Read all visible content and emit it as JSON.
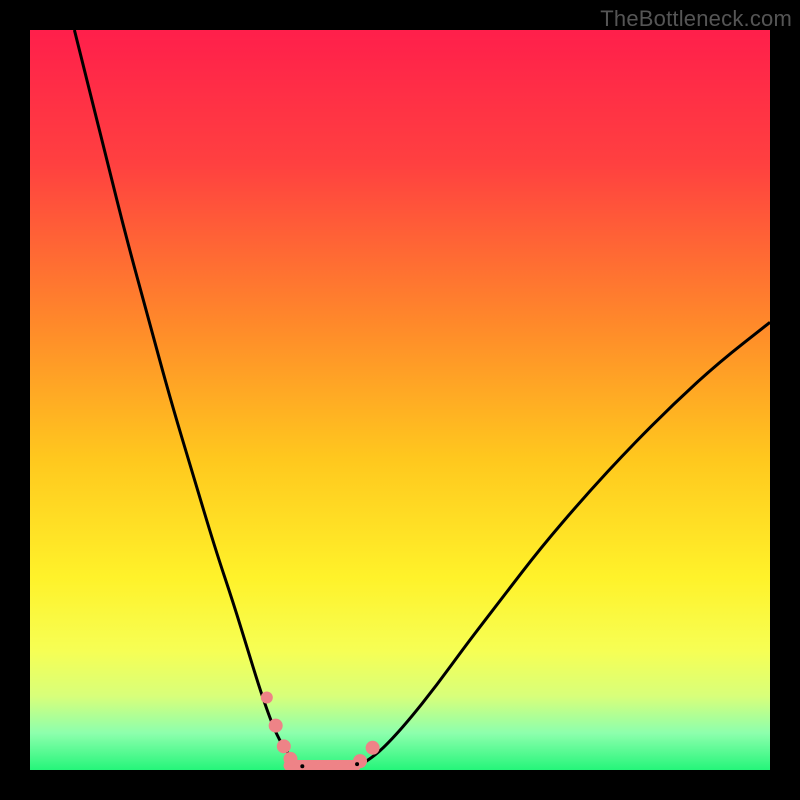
{
  "watermark": "TheBottleneck.com",
  "chart_data": {
    "type": "line",
    "title": "",
    "xlabel": "",
    "ylabel": "",
    "xlim": [
      0,
      100
    ],
    "ylim": [
      0,
      100
    ],
    "grid": false,
    "legend": false,
    "background_gradient_stops": [
      {
        "offset": 0.0,
        "color": "#ff1f4b"
      },
      {
        "offset": 0.18,
        "color": "#ff4040"
      },
      {
        "offset": 0.4,
        "color": "#ff8a2a"
      },
      {
        "offset": 0.58,
        "color": "#ffc81e"
      },
      {
        "offset": 0.74,
        "color": "#fff22a"
      },
      {
        "offset": 0.84,
        "color": "#f6ff55"
      },
      {
        "offset": 0.9,
        "color": "#d8ff7a"
      },
      {
        "offset": 0.95,
        "color": "#8dffad"
      },
      {
        "offset": 1.0,
        "color": "#25f57a"
      }
    ],
    "series": [
      {
        "name": "left-curve",
        "color": "#000000",
        "stroke_width": 3,
        "points": [
          {
            "x": 6.0,
            "y": 100.0
          },
          {
            "x": 8.0,
            "y": 92.0
          },
          {
            "x": 10.5,
            "y": 82.0
          },
          {
            "x": 13.0,
            "y": 72.0
          },
          {
            "x": 16.0,
            "y": 61.0
          },
          {
            "x": 19.0,
            "y": 50.0
          },
          {
            "x": 22.0,
            "y": 40.0
          },
          {
            "x": 25.0,
            "y": 30.0
          },
          {
            "x": 27.5,
            "y": 22.5
          },
          {
            "x": 29.5,
            "y": 16.0
          },
          {
            "x": 31.2,
            "y": 10.5
          },
          {
            "x": 32.8,
            "y": 6.0
          },
          {
            "x": 34.0,
            "y": 3.5
          },
          {
            "x": 35.2,
            "y": 1.8
          },
          {
            "x": 36.5,
            "y": 0.8
          },
          {
            "x": 37.5,
            "y": 0.4
          }
        ]
      },
      {
        "name": "right-curve",
        "color": "#000000",
        "stroke_width": 3,
        "points": [
          {
            "x": 44.5,
            "y": 0.6
          },
          {
            "x": 46.0,
            "y": 1.5
          },
          {
            "x": 48.0,
            "y": 3.2
          },
          {
            "x": 51.0,
            "y": 6.5
          },
          {
            "x": 55.0,
            "y": 11.5
          },
          {
            "x": 59.0,
            "y": 17.0
          },
          {
            "x": 64.0,
            "y": 23.5
          },
          {
            "x": 69.0,
            "y": 30.0
          },
          {
            "x": 75.0,
            "y": 37.0
          },
          {
            "x": 81.0,
            "y": 43.5
          },
          {
            "x": 87.0,
            "y": 49.5
          },
          {
            "x": 93.0,
            "y": 55.0
          },
          {
            "x": 100.0,
            "y": 60.5
          }
        ]
      },
      {
        "name": "floor-segment",
        "color": "#ee8387",
        "stroke_width": 11,
        "linecap": "round",
        "points": [
          {
            "x": 35.0,
            "y": 0.6
          },
          {
            "x": 44.0,
            "y": 0.6
          }
        ]
      }
    ],
    "markers": [
      {
        "name": "left-dot-1",
        "x": 32.0,
        "y": 9.8,
        "r": 6,
        "color": "#ee8387"
      },
      {
        "name": "left-dot-2",
        "x": 33.2,
        "y": 6.0,
        "r": 7,
        "color": "#ee8387"
      },
      {
        "name": "left-dot-3",
        "x": 34.3,
        "y": 3.2,
        "r": 7,
        "color": "#ee8387"
      },
      {
        "name": "left-dot-4",
        "x": 35.2,
        "y": 1.5,
        "r": 7,
        "color": "#ee8387"
      },
      {
        "name": "right-dot-1",
        "x": 44.6,
        "y": 1.2,
        "r": 7,
        "color": "#ee8387"
      },
      {
        "name": "right-dot-2",
        "x": 46.3,
        "y": 3.0,
        "r": 7,
        "color": "#ee8387"
      },
      {
        "name": "tiny-left",
        "x": 36.8,
        "y": 0.5,
        "r": 2,
        "color": "#000000"
      },
      {
        "name": "tiny-right",
        "x": 44.2,
        "y": 0.8,
        "r": 2,
        "color": "#000000"
      }
    ]
  }
}
